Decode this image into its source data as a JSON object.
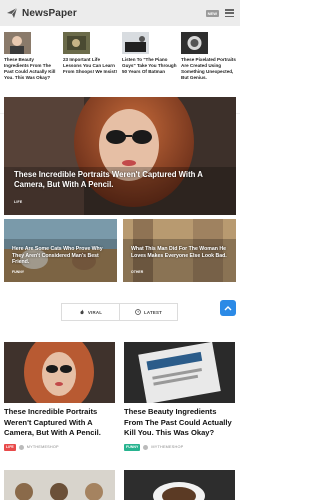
{
  "header": {
    "logo": "NewsPaper",
    "badge": "NEW"
  },
  "top_strip": [
    {
      "title": "These Beauty Ingredients From The Past Could Actually Kill You. This Was Okay?"
    },
    {
      "title": "23 Important Life Lessons You Can Learn From Shoops! We Insist!"
    },
    {
      "title": "Listen To \"The Piano Guys\" Take You Through 50 Years Of Batman"
    },
    {
      "title": "These Pixelated Portraits Are Created Using Something Unexpected, But Genius."
    }
  ],
  "hero": {
    "title": "These Incredible Portraits Weren't Captured With A Camera, But With A Pencil.",
    "tag": "LIFE"
  },
  "mid_cards": [
    {
      "title": "Here Are Some Cats Who Prove Why They Aren't Considered Man's Best Friend.",
      "tag": "FUNNY"
    },
    {
      "title": "What This Man Did For The Woman He Loves Makes Everyone Else Look Bad.",
      "tag": "OTHER"
    }
  ],
  "tabs": [
    {
      "label": "VIRAL"
    },
    {
      "label": "LATEST"
    }
  ],
  "cards": [
    {
      "title": "These Incredible Portraits Weren't Captured With A Camera, But With A Pencil.",
      "badge": "LIFE",
      "badge_color": "#e84a4a",
      "author": "MYTHEMESHOP"
    },
    {
      "title": "These Beauty Ingredients From The Past Could Actually Kill You. This Was Okay?",
      "badge": "FUNNY",
      "badge_color": "#27b38f",
      "author": "MYTHEMESHOP"
    }
  ],
  "colors": {
    "accent_blue": "#2b8ae6",
    "life_red": "#e84a4a",
    "funny_green": "#27b38f"
  }
}
